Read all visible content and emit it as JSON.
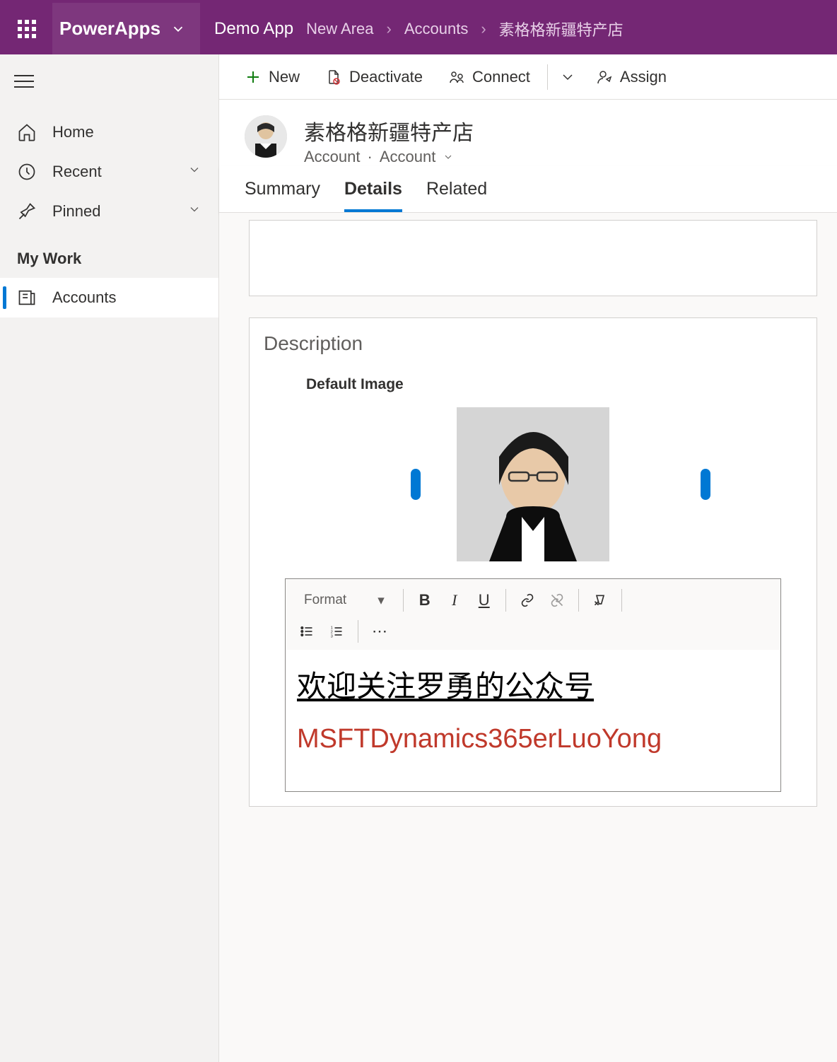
{
  "header": {
    "app_title": "PowerApps",
    "demo_app": "Demo App",
    "breadcrumb": [
      "New Area",
      "Accounts",
      "素格格新疆特产店"
    ]
  },
  "commands": {
    "new": "New",
    "deactivate": "Deactivate",
    "connect": "Connect",
    "assign": "Assign"
  },
  "sidebar": {
    "home": "Home",
    "recent": "Recent",
    "pinned": "Pinned",
    "section": "My Work",
    "accounts": "Accounts"
  },
  "record": {
    "title": "素格格新疆特产店",
    "entity": "Account",
    "form": "Account"
  },
  "tabs": {
    "summary": "Summary",
    "details": "Details",
    "related": "Related"
  },
  "description": {
    "section_title": "Description",
    "field_label": "Default Image"
  },
  "rte": {
    "format_label": "Format",
    "line1": "欢迎关注罗勇的公众号",
    "line2": "MSFTDynamics365erLuoYong"
  }
}
